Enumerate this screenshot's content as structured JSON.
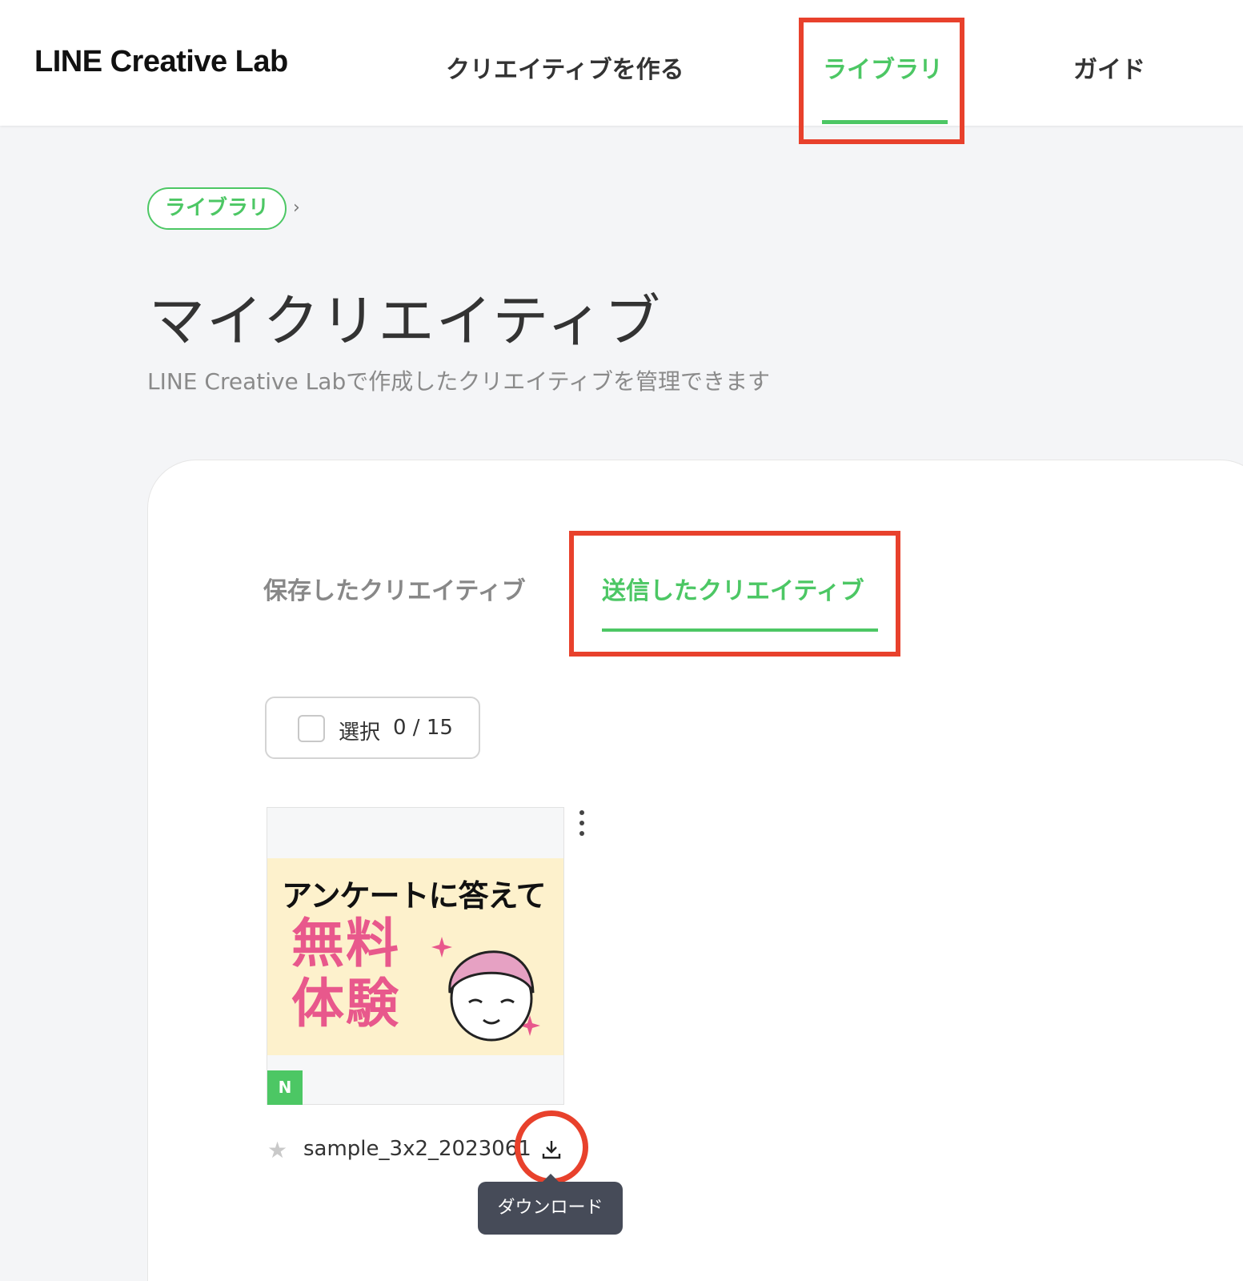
{
  "header": {
    "logo": "LINE Creative Lab",
    "nav": [
      {
        "label": "クリエイティブを作る"
      },
      {
        "label": "ライブラリ"
      },
      {
        "label": "ガイド"
      }
    ]
  },
  "breadcrumb": {
    "label": "ライブラリ",
    "separator": "›"
  },
  "page": {
    "title": "マイクリエイティブ",
    "subtitle": "LINE Creative Labで作成したクリエイティブを管理できます"
  },
  "tabs": [
    {
      "label": "保存したクリエイティブ"
    },
    {
      "label": "送信したクリエイティブ"
    }
  ],
  "select": {
    "label": "選択",
    "count": "0 / 15"
  },
  "creative": {
    "banner_line1": "アンケートに答えて",
    "banner_line2": "無料",
    "banner_line3": "体験",
    "badge": "N",
    "filename": "sample_3x2_2023061",
    "star_icon": "star-icon",
    "download_icon": "download-icon",
    "tooltip": "ダウンロード"
  },
  "colors": {
    "accent": "#4cc764",
    "highlight": "#e8412c",
    "tooltip_bg": "#464b58",
    "banner_bg": "#fdf1cc",
    "banner_pink": "#e8588c"
  }
}
